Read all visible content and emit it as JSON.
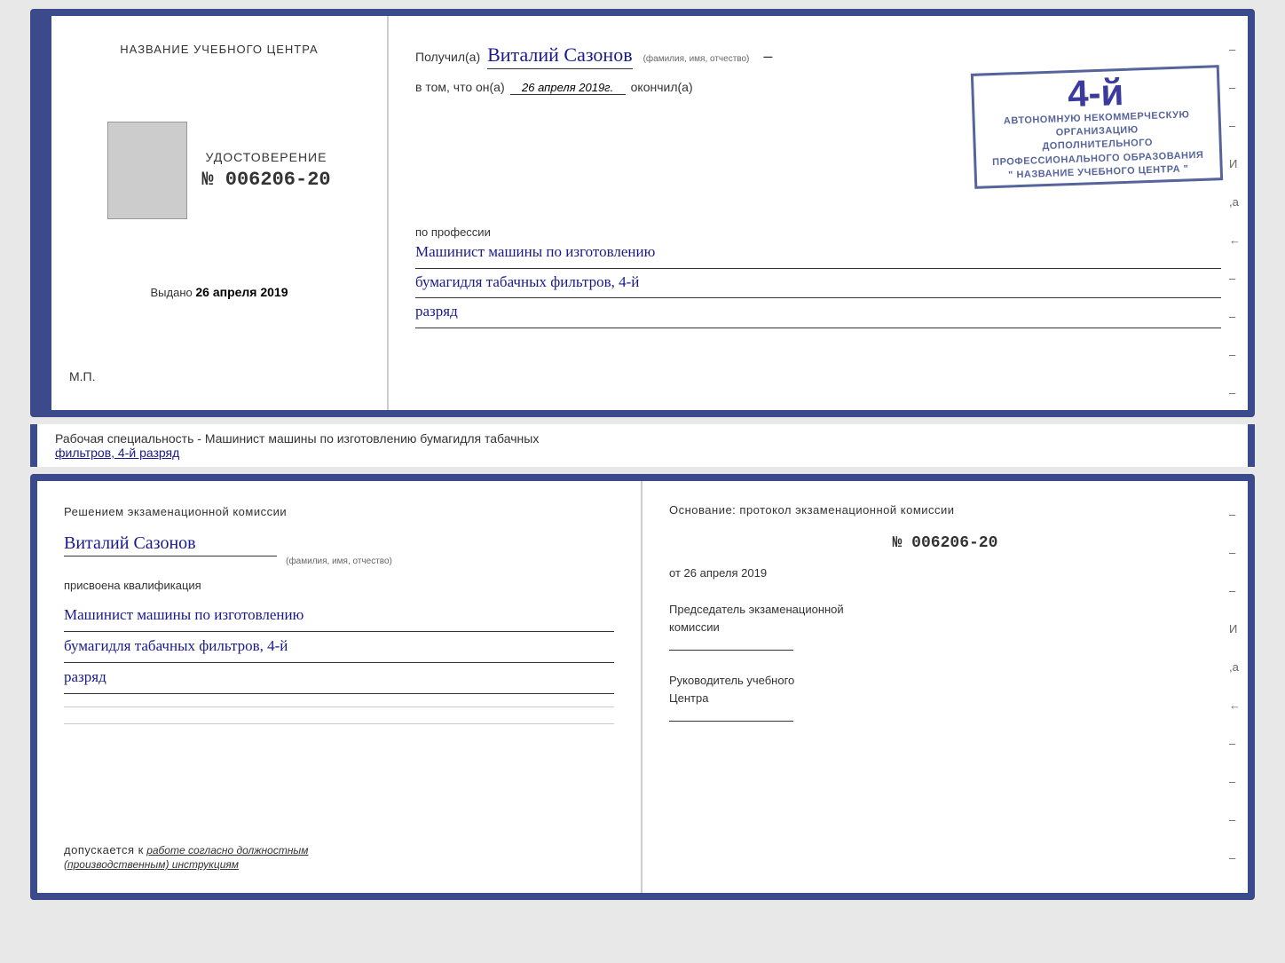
{
  "doc_top": {
    "left": {
      "center_title": "НАЗВАНИЕ УЧЕБНОГО ЦЕНТРА",
      "udostoverenie_label": "УДОСТОВЕРЕНИЕ",
      "number": "№ 006206-20",
      "vydano_label": "Выдано",
      "vydano_date": "26 апреля 2019",
      "mp": "М.П."
    },
    "right": {
      "poluchil": "Получил(а)",
      "name": "Виталий Сазонов",
      "name_hint": "(фамилия, имя, отчество)",
      "vtom": "в том, что он(a)",
      "date_italic": "26 апреля 2019г.",
      "okonchil": "окончил(a)",
      "stamp_number": "4-й",
      "stamp_line1": "АВТОНОМНУЮ НЕКОММЕРЧЕСКУЮ ОРГАНИЗАЦИЮ",
      "stamp_line2": "ДОПОЛНИТЕЛЬНОГО ПРОФЕССИОНАЛЬНОГО ОБРАЗОВАНИЯ",
      "stamp_line3": "\" НАЗВАНИЕ УЧЕБНОГО ЦЕНТРА \"",
      "po_professii": "по профессии",
      "profession_line1": "Машинист машины по изготовлению",
      "profession_line2": "бумагидля табачных фильтров, 4-й",
      "profession_line3": "разряд",
      "deco": [
        "–",
        "–",
        "–",
        "И",
        ",а",
        "←",
        "–",
        "–",
        "–",
        "–"
      ]
    }
  },
  "label_strip": {
    "text1": "Рабочая специальность - Машинист машины по изготовлению бумагидля табачных",
    "text2": "фильтров, 4-й разряд"
  },
  "doc_bottom": {
    "left": {
      "title": "Решением  экзаменационной  комиссии",
      "name": "Виталий Сазонов",
      "name_hint": "(фамилия, имя, отчество)",
      "prisvoena": "присвоена квалификация",
      "qual_line1": "Машинист машины по изготовлению",
      "qual_line2": "бумагидля табачных фильтров, 4-й",
      "qual_line3": "разряд",
      "dopuskaetsya_prefix": "допускается к",
      "dopuskaetsya_text": "работе согласно должностным",
      "dopuskaetsya_text2": "(производственным) инструкциям"
    },
    "right": {
      "osnovanie": "Основание:  протокол  экзаменационной  комиссии",
      "number": "№  006206-20",
      "ot_prefix": "от",
      "ot_date": "26 апреля 2019",
      "predsedatel_title": "Председатель экзаменационной",
      "predsedatel_title2": "комиссии",
      "rukovoditel_title": "Руководитель учебного",
      "rukovoditel_title2": "Центра",
      "deco": [
        "–",
        "–",
        "–",
        "И",
        ",а",
        "←",
        "–",
        "–",
        "–",
        "–"
      ]
    }
  }
}
